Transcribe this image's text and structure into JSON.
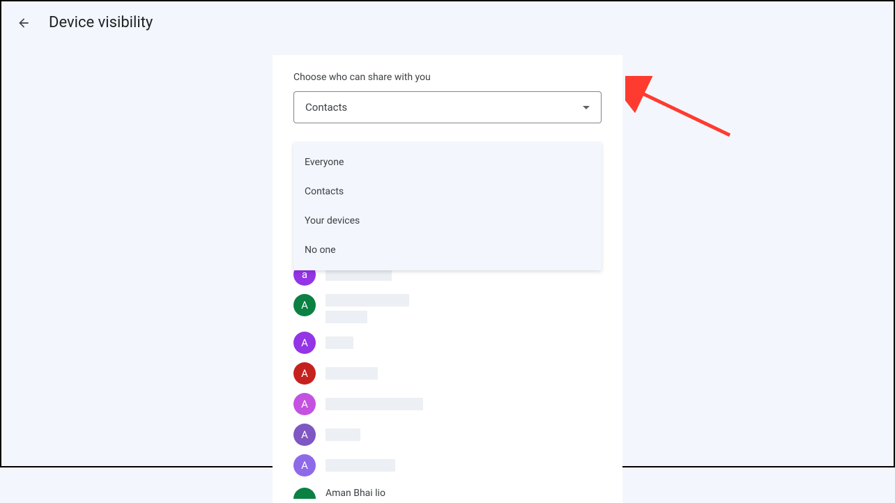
{
  "header": {
    "title": "Device visibility"
  },
  "main": {
    "sectionLabel": "Choose who can share with you",
    "dropdown": {
      "selected": "Contacts",
      "options": [
        "Everyone",
        "Contacts",
        "Your devices",
        "No one"
      ]
    },
    "contacts": [
      {
        "letter": "a",
        "color": "#9334e6",
        "width1": 95
      },
      {
        "letter": "A",
        "color": "#0b8043",
        "width1": 120,
        "width2": 60
      },
      {
        "letter": "A",
        "color": "#9334e6",
        "width1": 40
      },
      {
        "letter": "A",
        "color": "#c5221f",
        "width1": 75
      },
      {
        "letter": "A",
        "color": "#c352e0",
        "width1": 140
      },
      {
        "letter": "A",
        "color": "#7e57c2",
        "width1": 50
      },
      {
        "letter": "A",
        "color": "#8e6ae8",
        "width1": 100
      }
    ],
    "partialContact": {
      "name": "Aman Bhai lio"
    }
  }
}
